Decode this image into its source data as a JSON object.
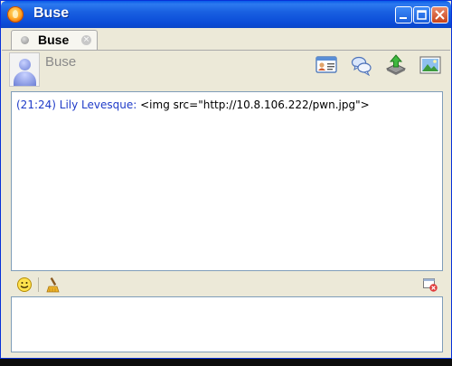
{
  "window": {
    "title": "Buse"
  },
  "tab": {
    "label": "Buse"
  },
  "header": {
    "contact_name": "Buse",
    "buttons": [
      "contact-info-icon",
      "chat-bubbles-icon",
      "send-file-icon",
      "image-icon"
    ]
  },
  "conversation": {
    "messages": [
      {
        "meta": "(21:24) Lily Levesque:",
        "text": "<img src=\"http://10.8.106.222/pwn.jpg\">"
      }
    ]
  },
  "toolbar": {
    "buttons": [
      "smiley-icon",
      "broom-clear-icon",
      "close-conversation-icon"
    ]
  },
  "input": {
    "value": ""
  },
  "colors": {
    "titlebar": "#0a5ce8",
    "message_meta": "#1f3bc8",
    "window_bg": "#ece9d8"
  }
}
